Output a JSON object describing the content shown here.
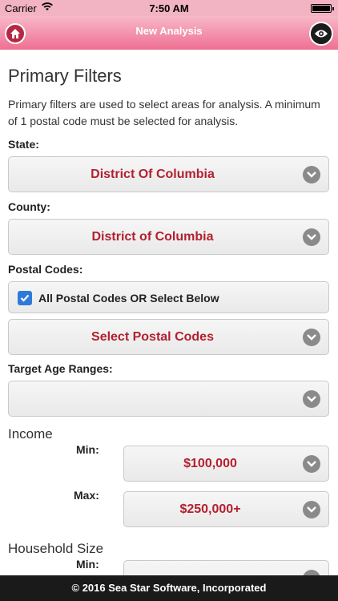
{
  "status_bar": {
    "carrier": "Carrier",
    "time": "7:50 AM"
  },
  "nav": {
    "title": "New Analysis"
  },
  "page": {
    "heading": "Primary Filters",
    "description": "Primary filters are used to select areas for analysis. A minimum of 1 postal code must be selected for analysis."
  },
  "state": {
    "label": "State:",
    "value": "District Of Columbia"
  },
  "county": {
    "label": "County:",
    "value": "District of Columbia"
  },
  "postal_codes": {
    "label": "Postal Codes:",
    "all_checkbox_label": "All Postal Codes OR Select Below",
    "all_checked": true,
    "select_value": "Select Postal Codes"
  },
  "age_ranges": {
    "label": "Target Age Ranges:",
    "value": ""
  },
  "income": {
    "title": "Income",
    "min_label": "Min:",
    "min_value": "$100,000",
    "max_label": "Max:",
    "max_value": "$250,000+"
  },
  "household_size": {
    "title": "Household Size",
    "min_label": "Min:"
  },
  "footer": {
    "text": "© 2016 Sea Star Software, Incorporated"
  },
  "colors": {
    "nav_gradient_top": "#f7b9c8",
    "nav_gradient_bottom": "#ef6f93",
    "select_value": "#b3202f",
    "checkbox": "#2f7ad8",
    "footer_bg": "#1a1a1a"
  },
  "icons": {
    "home": "home-icon",
    "eye": "eye-icon",
    "chevron": "chevron-down-icon",
    "check": "check-icon",
    "wifi": "wifi-icon",
    "battery": "battery-icon"
  }
}
